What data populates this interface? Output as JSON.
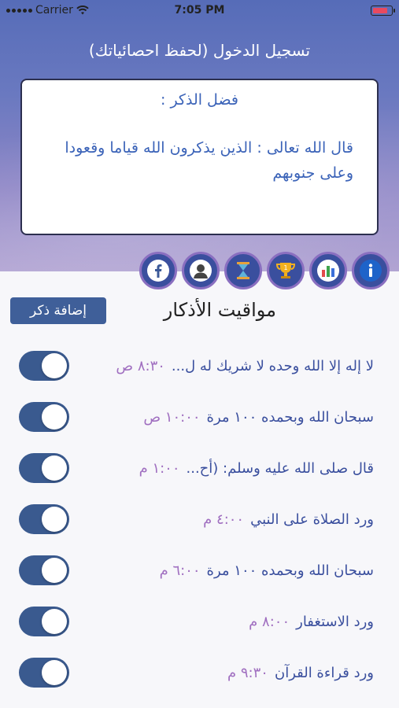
{
  "status_bar": {
    "carrier": "Carrier",
    "time": "7:05 PM"
  },
  "header": {
    "login_link": "تسجيل الدخول (لحفظ احصائياتك)"
  },
  "virtue_card": {
    "title": "فضل الذكر :",
    "text": "قال الله تعالى : الذين يذكرون الله قياما وقعودا وعلى جنوبهم"
  },
  "icons": [
    "info-icon",
    "statistics-icon",
    "trophy-icon",
    "hourglass-icon",
    "profile-icon",
    "facebook-icon"
  ],
  "section": {
    "title": "مواقيت الأذكار",
    "add_button": "إضافة ذكر"
  },
  "reminders": [
    {
      "label": "لا إله إلا الله وحده لا شريك له ل...",
      "time": "٨:٣٠ ص",
      "enabled": true
    },
    {
      "label": "سبحان الله وبحمده ١٠٠ مرة",
      "time": "١٠:٠٠ ص",
      "enabled": true
    },
    {
      "label": "قال صلى الله عليه وسلم: (أح...",
      "time": "١:٠٠ م",
      "enabled": true
    },
    {
      "label": "ورد الصلاة على النبي",
      "time": "٤:٠٠ م",
      "enabled": true
    },
    {
      "label": "سبحان الله وبحمده ١٠٠ مرة",
      "time": "٦:٠٠ م",
      "enabled": true
    },
    {
      "label": "ورد الاستغفار",
      "time": "٨:٠٠ م",
      "enabled": true
    },
    {
      "label": "ورد قراءة القرآن",
      "time": "٩:٣٠ م",
      "enabled": true
    }
  ]
}
